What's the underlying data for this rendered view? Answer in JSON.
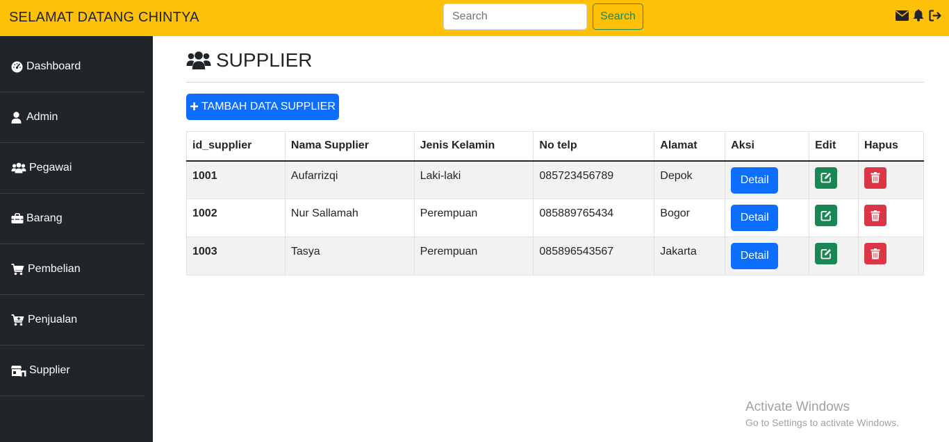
{
  "header": {
    "brand": "SELAMAT DATANG CHINTYA",
    "search_placeholder": "Search",
    "search_button": "Search",
    "icons": [
      "envelope-icon",
      "bell-icon",
      "logout-icon"
    ],
    "accent_color": "#ffc107"
  },
  "sidebar": {
    "items": [
      {
        "label": "Dashboard",
        "icon": "tachometer-icon"
      },
      {
        "label": "Admin",
        "icon": "user-icon"
      },
      {
        "label": "Pegawai",
        "icon": "users-icon"
      },
      {
        "label": "Barang",
        "icon": "toolbox-icon"
      },
      {
        "label": "Pembelian",
        "icon": "cart-icon"
      },
      {
        "label": "Penjualan",
        "icon": "cart-plus-icon"
      },
      {
        "label": "Supplier",
        "icon": "store-icon"
      }
    ]
  },
  "main": {
    "title": "SUPPLIER",
    "add_button": "TAMBAH DATA SUPPLIER",
    "table": {
      "headers": [
        "id_supplier",
        "Nama Supplier",
        "Jenis Kelamin",
        "No telp",
        "Alamat",
        "Aksi",
        "Edit",
        "Hapus"
      ],
      "detail_label": "Detail",
      "rows": [
        {
          "id": "1001",
          "nama": "Aufarrizqi",
          "jk": "Laki-laki",
          "telp": "085723456789",
          "alamat": "Depok"
        },
        {
          "id": "1002",
          "nama": "Nur Sallamah",
          "jk": "Perempuan",
          "telp": "085889765434",
          "alamat": "Bogor"
        },
        {
          "id": "1003",
          "nama": "Tasya",
          "jk": "Perempuan",
          "telp": "085896543567",
          "alamat": "Jakarta"
        }
      ]
    }
  },
  "watermark": {
    "line1": "Activate Windows",
    "line2": "Go to Settings to activate Windows."
  }
}
